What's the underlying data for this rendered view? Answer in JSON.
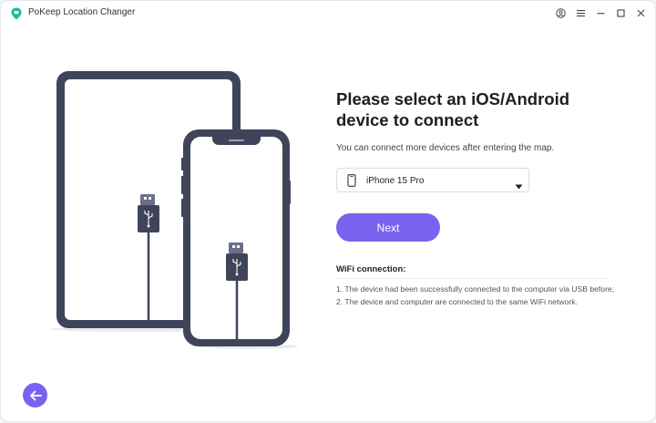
{
  "app": {
    "title": "PoKeep Location Changer",
    "brand_color": "#1fb89a"
  },
  "window_controls": [
    {
      "name": "account-icon"
    },
    {
      "name": "menu-icon"
    },
    {
      "name": "minimize-icon"
    },
    {
      "name": "maximize-icon"
    },
    {
      "name": "close-icon"
    }
  ],
  "main": {
    "heading": "Please select an iOS/Android device to connect",
    "subtext": "You can connect more devices after entering the map.",
    "device_select": {
      "value": "iPhone 15 Pro",
      "icon": "phone-icon"
    },
    "next_label": "Next",
    "wifi": {
      "title": "WiFi connection:",
      "items": [
        "1. The device had been successfully connected to the computer via USB before;",
        "2. The device and computer are connected to the same WiFi network."
      ]
    }
  },
  "colors": {
    "accent": "#7b62ee",
    "device_outline": "#3f4459"
  }
}
